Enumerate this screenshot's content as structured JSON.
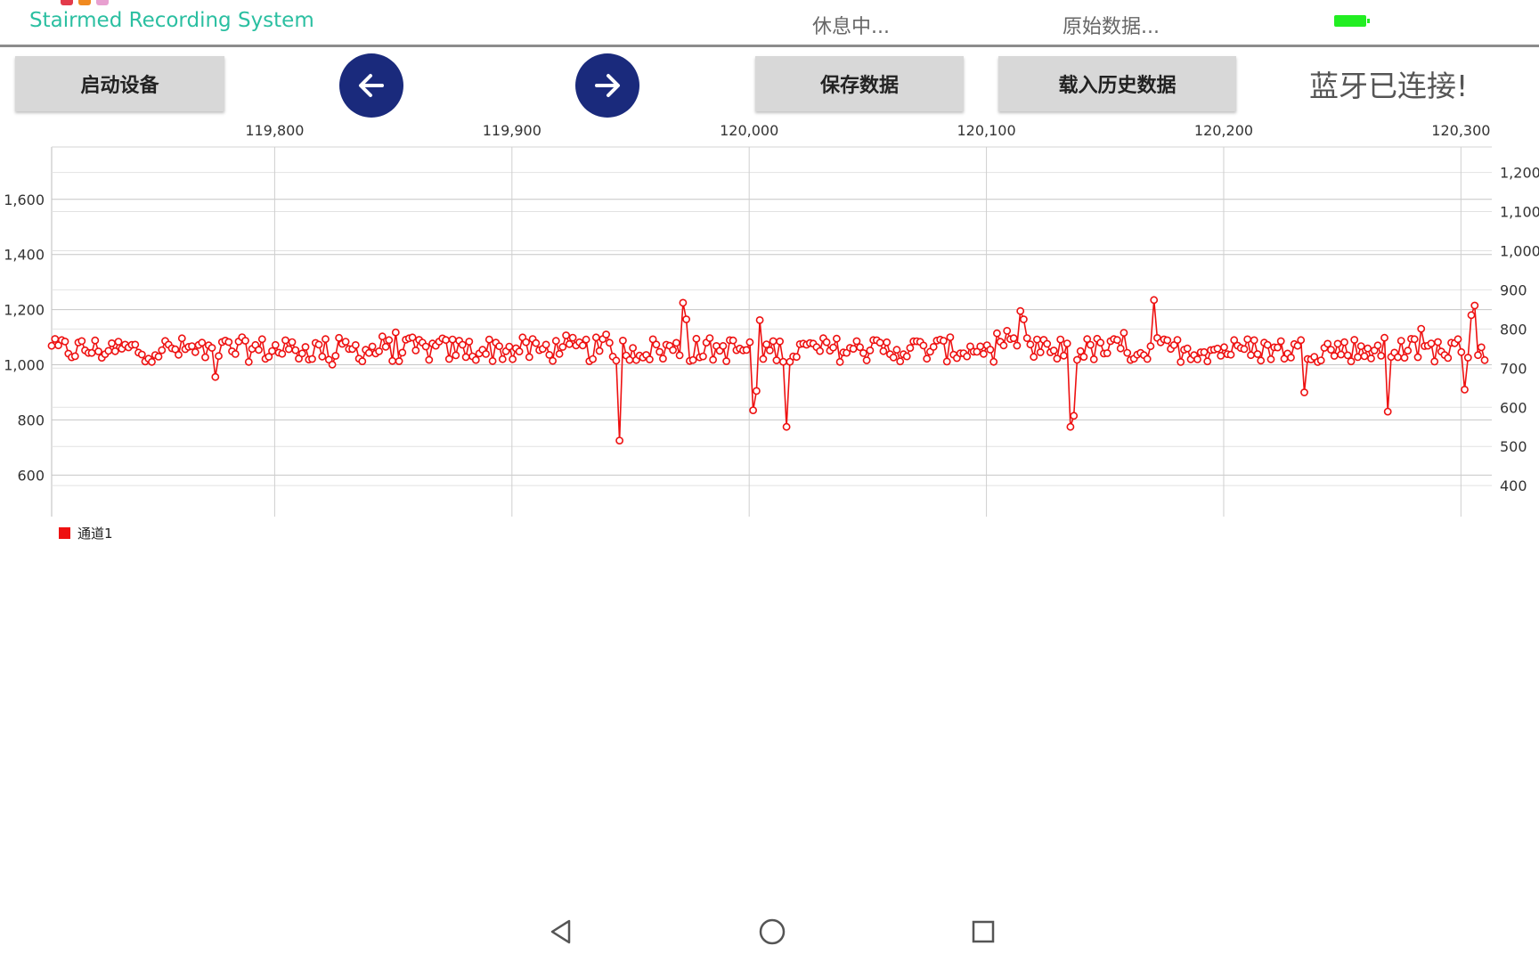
{
  "header": {
    "app_title": "Stairmed Recording System",
    "status": "休息中...",
    "data_mode": "原始数据...",
    "battery_color": "#22ee22"
  },
  "toolbar": {
    "start_label": "启动设备",
    "prev_icon": "arrow-left-icon",
    "next_icon": "arrow-right-icon",
    "save_label": "保存数据",
    "load_label": "载入历史数据",
    "bluetooth_status": "蓝牙已连接!"
  },
  "chart_data": {
    "type": "line",
    "x_ticks": [
      "119,800",
      "119,900",
      "120,000",
      "120,100",
      "120,200",
      "120,300"
    ],
    "x_tick_values": [
      119800,
      119900,
      120000,
      120100,
      120200,
      120300
    ],
    "xlim": [
      119706,
      120313
    ],
    "y_left_ticks": [
      "600",
      "800",
      "1,000",
      "1,200",
      "1,400",
      "1,600"
    ],
    "y_left_values": [
      600,
      800,
      1000,
      1200,
      1400,
      1600
    ],
    "ylim_left": [
      488,
      1790
    ],
    "y_right_ticks": [
      "400",
      "500",
      "600",
      "700",
      "800",
      "900",
      "1,000",
      "1,100",
      "1,200"
    ],
    "y_right_values": [
      400,
      500,
      600,
      700,
      800,
      900,
      1000,
      1100,
      1200
    ],
    "ylim_right": [
      348,
      1265
    ],
    "grid": true,
    "legend_position": "bottom-left",
    "series": [
      {
        "name": "通道1",
        "color": "#ee1111",
        "baseline": 1055,
        "x_start": 119706,
        "x_end": 120310
      }
    ]
  },
  "navbar": {
    "back_icon": "triangle-back-icon",
    "home_icon": "circle-home-icon",
    "recent_icon": "square-recent-icon"
  }
}
